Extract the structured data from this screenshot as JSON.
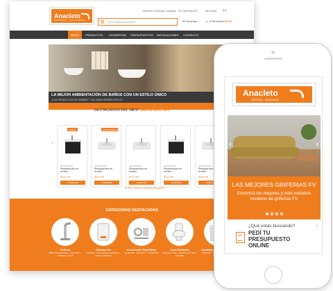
{
  "colors": {
    "accent": "#ef7d1e",
    "nav_bg": "#3a3a3a"
  },
  "desktop": {
    "logo": {
      "name": "Anacleto",
      "tagline": "GRIFERIA · SANITARIOS"
    },
    "top_info": "Atención Comercial: Consultas · Tel: 0348 4811677",
    "account_label": "Mi Cuenta",
    "social": "f  t",
    "search": {
      "placeholder": "¿Qué estás buscando?",
      "icon": "search-icon"
    },
    "favorites_label": "♥ Favoritos",
    "cart": {
      "label": "Mi Carrito",
      "count": "0",
      "total": "$0.00"
    },
    "nav": [
      "INICIO",
      "PRODUCTOS",
      "SHOWROOM",
      "PRESUPUESTOS",
      "INSTALACIONES",
      "CONTACTO"
    ],
    "hero": {
      "title": "LA MEJOR AMBIENTACIÓN DE BAÑOS CON UN ESTILO ÚNICO",
      "subtitle": "¡LOS PRODUCTOS DE ROBINET Y SU GRAN DISEÑO ESTILO!"
    },
    "section_title": {
      "plain": "DESTACADOS DEL MES!",
      "highlight": "HASTA 20% OFF"
    },
    "products": [
      {
        "badge": "NUEVO",
        "brand": "SANITARIOS",
        "name": "Receptáculos de acrílico",
        "price": "$119,99",
        "button": "COMPRAR",
        "img": "dark"
      },
      {
        "badge": "DESTACADOS",
        "brand": "SANITARIOS",
        "name": "Receptáculos de acrílico",
        "price": "$119,99",
        "button": "COMPRAR",
        "img": "light"
      },
      {
        "badge": "",
        "brand": "SANITARIOS",
        "name": "Receptáculos de acrílico",
        "price": "$119,99",
        "button": "COMPRAR",
        "img": "light"
      },
      {
        "badge": "",
        "brand": "SANITARIOS",
        "name": "Receptáculos de acrílico",
        "price": "$119,99",
        "button": "COMPRAR",
        "img": "dark"
      },
      {
        "badge": "",
        "brand": "SANITARIOS",
        "name": "Receptáculos de acrílico",
        "price": "$119,99",
        "button": "COMPRAR",
        "img": "light"
      }
    ],
    "view_all": "▼ VER TODOS LOS DESTACADOS",
    "categories_title": "CATEGORÍAS DESTACADAS",
    "categories": [
      {
        "name": "Grifería",
        "desc": "Baño monocomando · Exposición · Cocina de pared"
      },
      {
        "name": "Calefacción",
        "desc": "Calderas · Termotanques eléctricos · Tanque calefactor"
      },
      {
        "name": "Accesorios Para Baño",
        "desc": "Portarrollo · Percheros · Cortadores"
      },
      {
        "name": "Loza Sanitaria",
        "desc": "Inodoros y bidés · Bachas para baño · Mochilas"
      },
      {
        "name": "Amoblamiento para Baño",
        "desc": "Vanitories · Espejos · Kit de baño · Botiquines"
      }
    ]
  },
  "mobile": {
    "logo": {
      "name": "Anacleto",
      "tagline": "GRIFERIA · SANITARIOS"
    },
    "hero_title": "LAS MEJORES GRIFERIAS FV",
    "hero_subtitle": "Encontrá los mejores y más variados modelos de griferías FV",
    "quote_question": "¿Qué estás buscando?",
    "quote_cta": "PEDÍ TU PRESUPUESTO ONLINE",
    "arrow_left": "‹",
    "arrow_right": "›",
    "quote_arrow": "›"
  }
}
